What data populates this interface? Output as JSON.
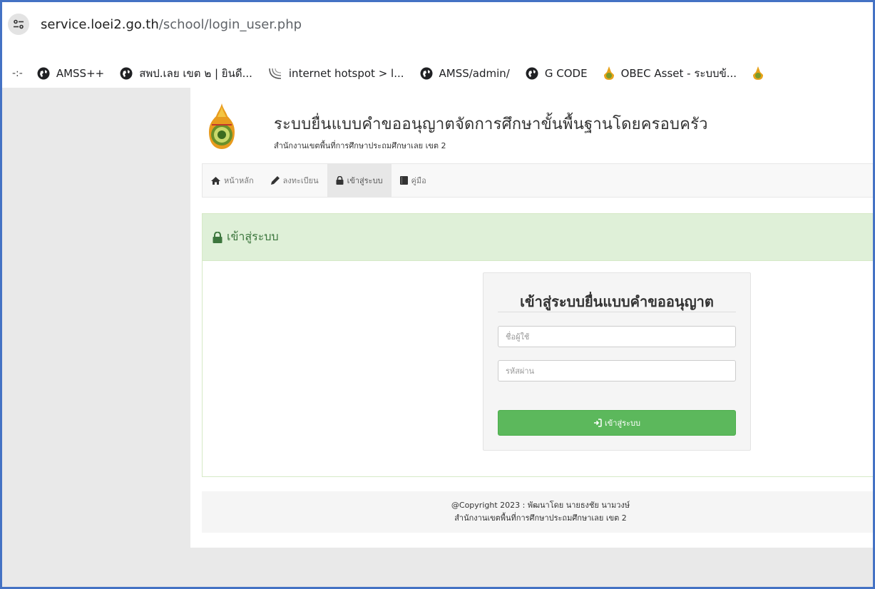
{
  "browser": {
    "url_host": "service.loei2.go.th",
    "url_path": "/school/login_user.php",
    "bookmarks_prefix": "-:-",
    "bookmarks": [
      {
        "label": "AMSS++",
        "icon": "globe-icon"
      },
      {
        "label": "สพป.เลย เขต ๒ | ยินดี...",
        "icon": "globe-icon"
      },
      {
        "label": "internet hotspot > l...",
        "icon": "hotspot-icon"
      },
      {
        "label": "AMSS/admin/",
        "icon": "globe-icon"
      },
      {
        "label": "G CODE",
        "icon": "globe-icon"
      },
      {
        "label": "OBEC Asset - ระบบข้...",
        "icon": "obec-emblem-icon"
      }
    ]
  },
  "site": {
    "title": "ระบบยื่นแบบคำขออนุญาตจัดการศึกษาขั้นพื้นฐานโดยครอบครัว",
    "subtitle": "สำนักงานเขตพื้นที่การศึกษาประถมศึกษาเลย เขต 2"
  },
  "nav": {
    "items": [
      {
        "label": "หน้าหลัก",
        "icon": "home-icon",
        "active": false
      },
      {
        "label": "ลงทะเบียน",
        "icon": "pencil-icon",
        "active": false
      },
      {
        "label": "เข้าสู่ระบบ",
        "icon": "lock-icon",
        "active": true
      },
      {
        "label": "คู่มือ",
        "icon": "book-icon",
        "active": false
      }
    ]
  },
  "panel": {
    "heading": "เข้าสู่ระบบ"
  },
  "login": {
    "title": "เข้าสู่ระบบยื่นแบบคำขออนุญาต",
    "username_placeholder": "ชื่อผู้ใช้",
    "password_placeholder": "รหัสผ่าน",
    "submit_label": "เข้าสู่ระบบ"
  },
  "footer": {
    "line1": "@Copyright 2023 : พัฒนาโดย นายธงชัย นามวงษ์",
    "line2": "สำนักงานเขตพื้นที่การศึกษาประถมศึกษาเลย เขต 2"
  },
  "colors": {
    "panel_header_bg": "#dff0d8",
    "panel_header_text": "#3c763d",
    "button_green": "#5cb85c",
    "frame_border": "#4472c4"
  }
}
